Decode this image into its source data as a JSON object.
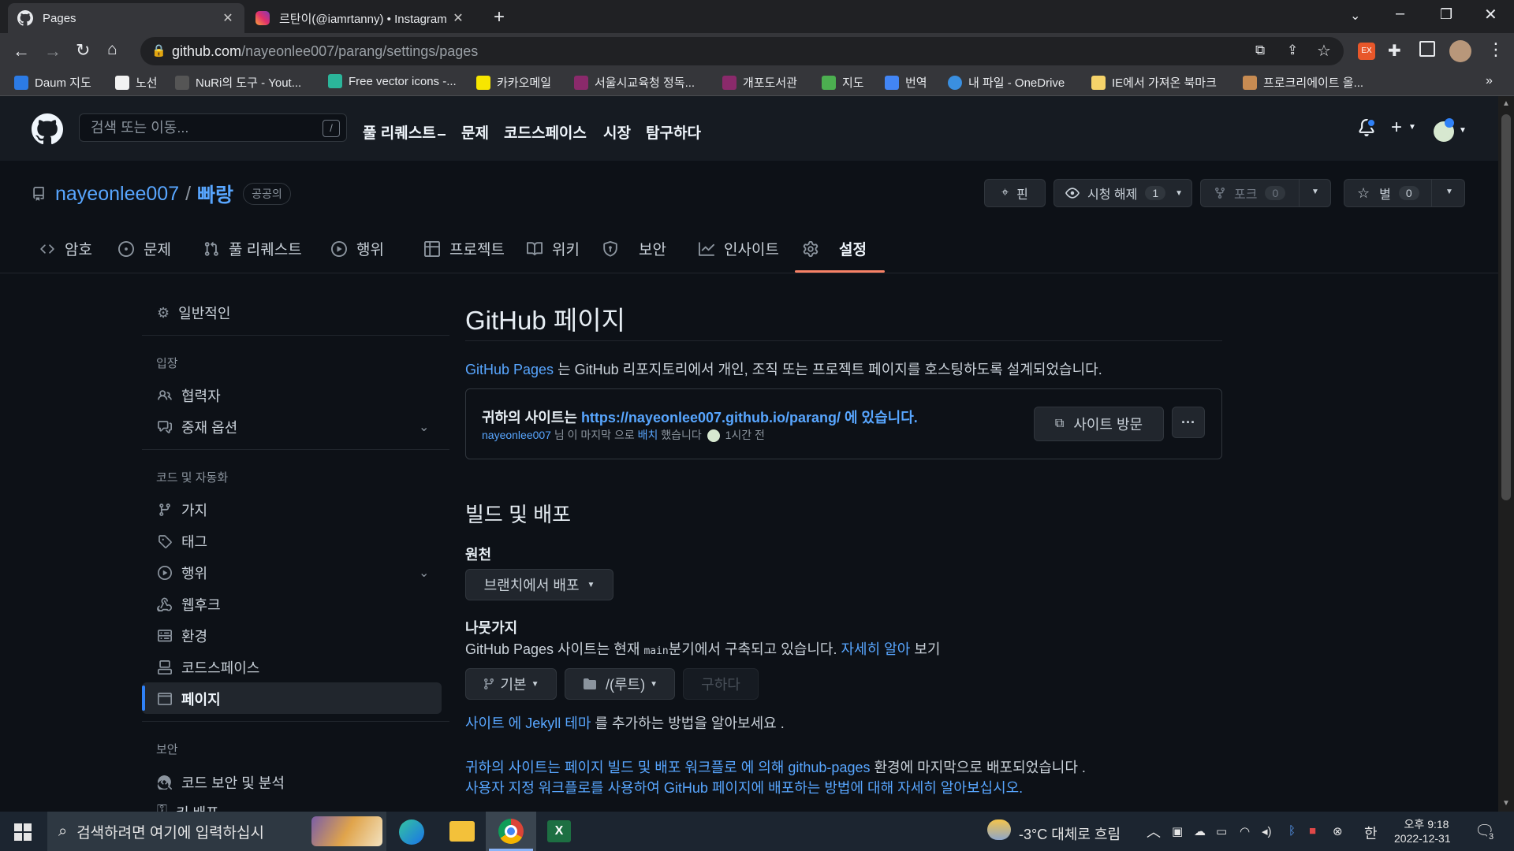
{
  "browser": {
    "tabs": [
      {
        "title": "Pages",
        "active": true
      },
      {
        "title": "르탄이(@iamrtanny) • Instagram",
        "active": false
      }
    ],
    "url_host": "github.com",
    "url_path": "/nayeonlee007/parang/settings/pages",
    "bookmarks": [
      "Daum 지도",
      "노선",
      "NuRi의 도구 - Yout...",
      "Free vector icons -...",
      "카카오메일",
      "서울시교육청 정독...",
      "개포도서관",
      "지도",
      "번역",
      "내 파일 - OneDrive",
      "IE에서 가져온 북마크",
      "프로크리에이트 올..."
    ]
  },
  "header": {
    "search_placeholder": "검색 또는 이동...",
    "slash": "/",
    "nav": [
      "풀 리퀘스트",
      "문제",
      "코드스페이스",
      "시장",
      "탐구하다"
    ]
  },
  "repo": {
    "owner": "nayeonlee007",
    "separator": "/",
    "name": "빠랑",
    "visibility": "공공의",
    "pin_label": "핀",
    "watch_label": "시청 해제",
    "watch_count": "1",
    "fork_label": "포크",
    "fork_count": "0",
    "star_label": "별",
    "star_count": "0",
    "tabs": [
      "암호",
      "문제",
      "풀 리퀘스트",
      "행위",
      "프로젝트",
      "위키",
      "보안",
      "인사이트",
      "설정"
    ]
  },
  "sidebar": {
    "general": "일반적인",
    "section_access": "입장",
    "collaborators": "협력자",
    "moderation": "중재 옵션",
    "section_code": "코드 및 자동화",
    "branches": "가지",
    "tags": "태그",
    "actions": "행위",
    "webhooks": "웹후크",
    "environments": "환경",
    "codespaces": "코드스페이스",
    "pages": "페이지",
    "section_security": "보안",
    "code_security": "코드 보안 및 분석",
    "deploy_keys": "키 배포"
  },
  "main": {
    "title": "GitHub 페이지",
    "intro_link": "GitHub Pages",
    "intro_text": "는 GitHub 리포지토리에서 개인, 조직 또는 프로젝트 페이지를 호스팅하도록 설계되었습니다.",
    "site_prefix": "귀하의 사이트는",
    "site_url": "https://nayeonlee007.github.io/parang/",
    "site_suffix": "에 있습니다.",
    "deploy_user": "nayeonlee007",
    "deploy_text1": "님 이 마지막 으로",
    "deploy_link": "배치",
    "deploy_text2": "했습니다",
    "deploy_time": "1시간 전",
    "visit_site": "사이트 방문",
    "more": "···",
    "build_title": "빌드 및 배포",
    "source_label": "원천",
    "source_value": "브랜치에서 배포",
    "branch_label": "나뭇가지",
    "branch_text1": "GitHub Pages 사이트는 현재",
    "branch_code": "main",
    "branch_text2": "분기에서 구축되고 있습니다.",
    "branch_link": "자세히 알아",
    "branch_text3": "보기",
    "branch_select": "기본",
    "folder_select": "/(루트)",
    "save_button": "구하다",
    "jekyll_link1": "사이트 에",
    "jekyll_link2": "Jekyll 테마",
    "jekyll_text": "를 추가하는 방법을 알아보세요 .",
    "workflow_link1": "귀하의 사이트는",
    "workflow_link2": "페이지 빌드 및 배포 워크플로",
    "workflow_link3": "에 의해",
    "workflow_link4": "github-pages",
    "workflow_text": "환경에 마지막으로 배포되었습니다 .",
    "custom_link": "사용자 지정 워크플로를 사용하여 GitHub 페이지에 배포하는 방법에 대해 자세히 알아보십시오."
  },
  "taskbar": {
    "search_placeholder": "검색하려면 여기에 입력하십시",
    "weather": "-3°C 대체로 흐림",
    "ime": "한",
    "time": "오후 9:18",
    "date": "2022-12-31",
    "notifications": "3"
  },
  "colors": {
    "bg": "#0d1117",
    "header_bg": "#161b22",
    "link": "#58a6ff",
    "active_tab_underline": "#f78166"
  }
}
